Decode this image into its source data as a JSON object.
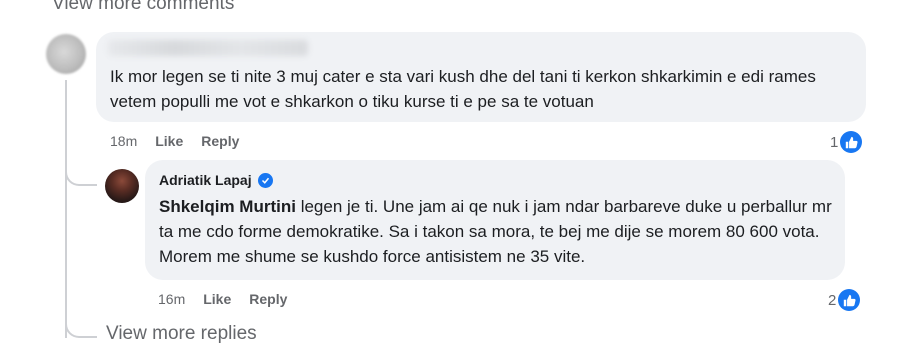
{
  "top_link": "View more comments",
  "comments": [
    {
      "text": "Ik mor legen se ti nite 3 muj cater e sta vari kush dhe del tani ti kerkon shkarkimin e edi rames vetem populli me vot e shkarkon o tiku kurse ti e pe sa te votuan",
      "time": "18m",
      "like_label": "Like",
      "reply_label": "Reply",
      "reaction_count": "1"
    },
    {
      "author": "Adriatik Lapaj",
      "mention": "Shkelqim Murtini",
      "text": " legen je ti. Une jam ai qe nuk i jam ndar barbareve duke u perballur mr ta me cdo forme demokratike. Sa i takon sa mora, te bej me dije se morem 80 600 vota. Morem me shume se kushdo force antisistem ne 35 vite.",
      "time": "16m",
      "like_label": "Like",
      "reply_label": "Reply",
      "reaction_count": "2"
    }
  ],
  "view_more_replies": "View more replies",
  "colors": {
    "accent": "#1877f2",
    "bubble": "#f0f2f5",
    "muted": "#65676b"
  }
}
